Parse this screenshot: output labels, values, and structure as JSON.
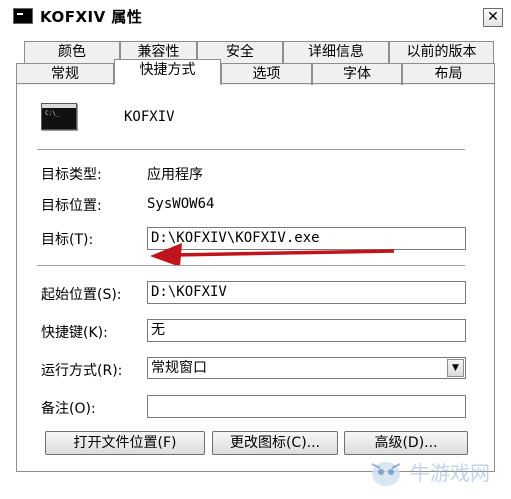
{
  "window": {
    "title": "KOFXIV 属性",
    "close_glyph": "✕"
  },
  "tabs_row1": [
    "颜色",
    "兼容性",
    "安全",
    "详细信息",
    "以前的版本"
  ],
  "tabs_row2": [
    "常规",
    "快捷方式",
    "选项",
    "字体",
    "布局"
  ],
  "active_tab": "快捷方式",
  "shortcut": {
    "name": "KOFXIV",
    "target_type_label": "目标类型:",
    "target_type_value": "应用程序",
    "target_location_label": "目标位置:",
    "target_location_value": "SysWOW64",
    "target_label": "目标(T):",
    "target_value": "D:\\KOFXIV\\KOFXIV.exe",
    "start_in_label": "起始位置(S):",
    "start_in_value": "D:\\KOFXIV",
    "hotkey_label": "快捷键(K):",
    "hotkey_value": "无",
    "run_label": "运行方式(R):",
    "run_value": "常规窗口",
    "comment_label": "备注(O):",
    "comment_value": ""
  },
  "buttons": {
    "open_location": "打开文件位置(F)",
    "change_icon": "更改图标(C)...",
    "advanced": "高级(D)..."
  },
  "icons": {
    "app": "console-icon",
    "arrow": "red-arrow-annotation",
    "dropdown": "chevron-down-icon"
  },
  "colors": {
    "arrow": "#c0141c",
    "watermark": "#8fb2d8"
  },
  "watermark_text": "牛游戏网"
}
